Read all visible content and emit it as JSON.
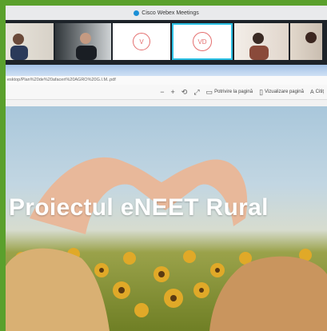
{
  "window": {
    "title": "Cisco Webex Meetings",
    "app_icon": "webex-icon"
  },
  "participants": [
    {
      "kind": "video",
      "initials": ""
    },
    {
      "kind": "video",
      "initials": ""
    },
    {
      "kind": "avatar",
      "initials": "V"
    },
    {
      "kind": "avatar",
      "initials": "VD",
      "selected": true
    },
    {
      "kind": "video",
      "initials": ""
    },
    {
      "kind": "video",
      "initials": ""
    }
  ],
  "address": {
    "text": "esktop/Plan%20de%20afaceri%20AGRO%20G.I.M..pdf"
  },
  "toolbar": {
    "zoom_out": "−",
    "zoom_in": "+",
    "rotate_icon": "rotate-icon",
    "fit_icon": "expand-icon",
    "fit_page_label": "Potrivire la pagină",
    "page_view_label": "Vizualizare pagină",
    "read_aloud_label": "Citiț"
  },
  "document": {
    "title": "Proiectul eNEET Rural"
  },
  "colors": {
    "border": "#5aa02c",
    "accent": "#2bc0e4",
    "avatar": "#e46f6f"
  }
}
